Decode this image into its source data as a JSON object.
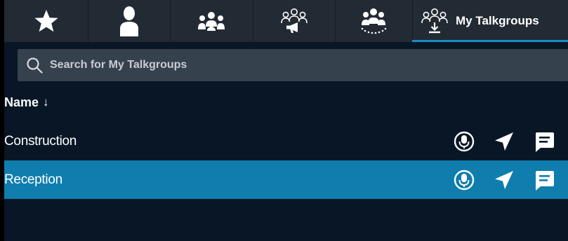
{
  "tabs": [
    {
      "icon": "star-icon",
      "label": ""
    },
    {
      "icon": "user-icon",
      "label": ""
    },
    {
      "icon": "users-group-icon",
      "label": ""
    },
    {
      "icon": "broadcast-group-icon",
      "label": ""
    },
    {
      "icon": "dispatch-group-icon",
      "label": ""
    },
    {
      "icon": "my-talkgroups-icon",
      "label": "My Talkgroups"
    }
  ],
  "search": {
    "placeholder": "Search for My Talkgroups"
  },
  "list": {
    "column_header": "Name",
    "sort_arrow": "↓",
    "rows": [
      {
        "name": "Construction",
        "selected": false
      },
      {
        "name": "Reception",
        "selected": true
      }
    ]
  },
  "colors": {
    "background": "#081626",
    "tabbar": "#222a34",
    "accent": "#1a8cc3",
    "selected_row": "#0f7dad",
    "search_bg": "#36414e"
  }
}
